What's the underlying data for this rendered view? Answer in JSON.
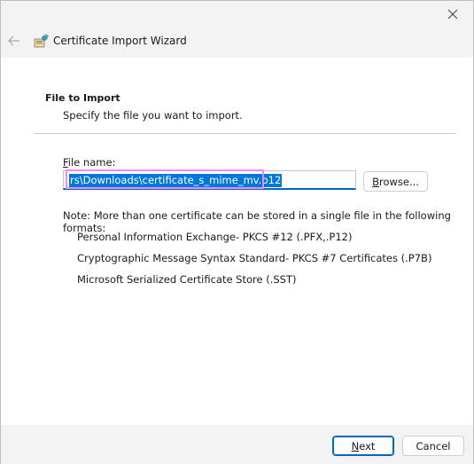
{
  "titlebar": {
    "title": "Certificate Import Wizard"
  },
  "section": {
    "heading": "File to Import",
    "subheading": "Specify the file you want to import."
  },
  "file_name": {
    "label_prefix": "F",
    "label_rest": "ile name:",
    "value": "rs\\Downloads\\certificate_s_mime_mv.p12"
  },
  "browse_button": {
    "label_prefix": "B",
    "label_rest": "rowse..."
  },
  "note": "Note:  More than one certificate can be stored in a single file in the following formats:",
  "formats": [
    "Personal Information Exchange- PKCS #12 (.PFX,.P12)",
    "Cryptographic Message Syntax Standard- PKCS #7 Certificates (.P7B)",
    "Microsoft Serialized Certificate Store (.SST)"
  ],
  "footer": {
    "next_prefix": "N",
    "next_rest": "ext",
    "cancel": "Cancel"
  },
  "colors": {
    "accent": "#0067c0",
    "selection": "#0078d7",
    "highlight_box": "#f08cf0"
  }
}
